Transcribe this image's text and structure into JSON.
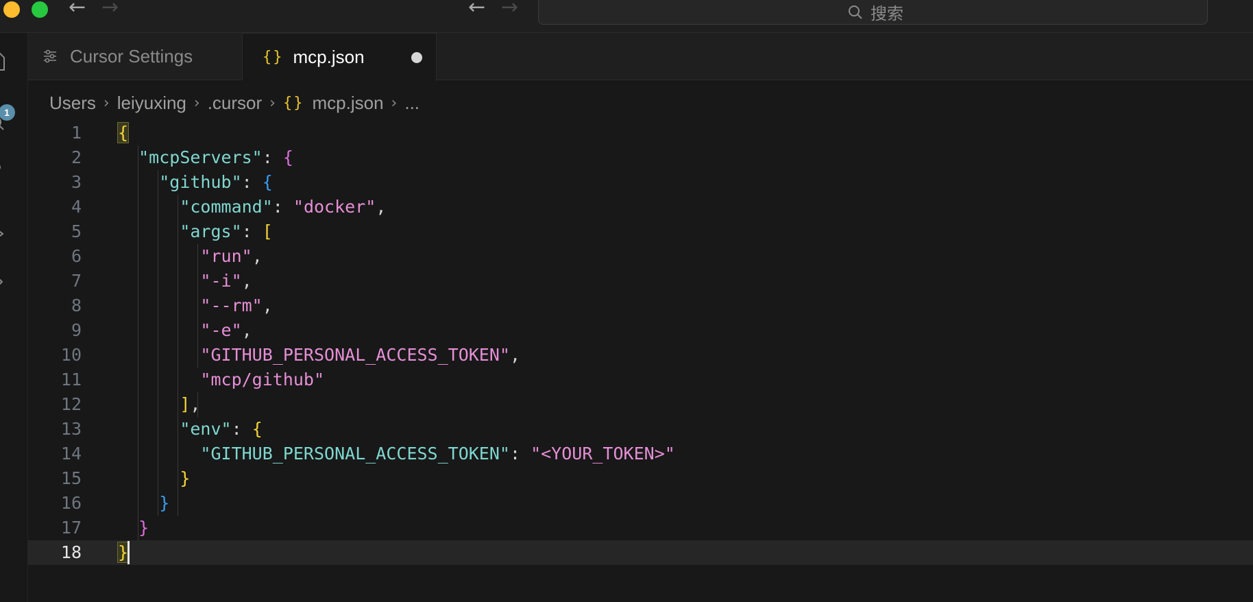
{
  "titlebar": {
    "search_placeholder": "搜索",
    "back_icon": "arrow-left-icon",
    "forward_icon": "arrow-right-icon",
    "search_icon": "magnifier-icon"
  },
  "activity_bar": {
    "badge_count": "1"
  },
  "tabs": [
    {
      "label": "Cursor Settings",
      "icon": "settings-sliders-icon",
      "active": false
    },
    {
      "label": "mcp.json",
      "icon": "json-braces-icon",
      "icon_text": "{}",
      "active": true,
      "dirty": true
    }
  ],
  "breadcrumb": [
    "Users",
    "leiyuxing",
    ".cursor",
    "mcp.json",
    "..."
  ],
  "breadcrumb_icon_text": "{}",
  "editor": {
    "current_line": 18,
    "lines": [
      {
        "n": "1",
        "tokens": [
          {
            "t": "{",
            "c": "t-b1 t-bhl"
          }
        ]
      },
      {
        "n": "2",
        "tokens": [
          {
            "t": "  "
          },
          {
            "t": "\"mcpServers\"",
            "c": "t-key"
          },
          {
            "t": ": ",
            "c": "t-punc"
          },
          {
            "t": "{",
            "c": "t-b2"
          }
        ]
      },
      {
        "n": "3",
        "tokens": [
          {
            "t": "    "
          },
          {
            "t": "\"github\"",
            "c": "t-key"
          },
          {
            "t": ": ",
            "c": "t-punc"
          },
          {
            "t": "{",
            "c": "t-b3"
          }
        ]
      },
      {
        "n": "4",
        "tokens": [
          {
            "t": "      "
          },
          {
            "t": "\"command\"",
            "c": "t-key"
          },
          {
            "t": ": ",
            "c": "t-punc"
          },
          {
            "t": "\"docker\"",
            "c": "t-str"
          },
          {
            "t": ",",
            "c": "t-punc"
          }
        ]
      },
      {
        "n": "5",
        "tokens": [
          {
            "t": "      "
          },
          {
            "t": "\"args\"",
            "c": "t-key"
          },
          {
            "t": ": ",
            "c": "t-punc"
          },
          {
            "t": "[",
            "c": "t-b1"
          }
        ]
      },
      {
        "n": "6",
        "tokens": [
          {
            "t": "        "
          },
          {
            "t": "\"run\"",
            "c": "t-str"
          },
          {
            "t": ",",
            "c": "t-punc"
          }
        ]
      },
      {
        "n": "7",
        "tokens": [
          {
            "t": "        "
          },
          {
            "t": "\"-i\"",
            "c": "t-str"
          },
          {
            "t": ",",
            "c": "t-punc"
          }
        ]
      },
      {
        "n": "8",
        "tokens": [
          {
            "t": "        "
          },
          {
            "t": "\"--rm\"",
            "c": "t-str"
          },
          {
            "t": ",",
            "c": "t-punc"
          }
        ]
      },
      {
        "n": "9",
        "tokens": [
          {
            "t": "        "
          },
          {
            "t": "\"-e\"",
            "c": "t-str"
          },
          {
            "t": ",",
            "c": "t-punc"
          }
        ]
      },
      {
        "n": "10",
        "tokens": [
          {
            "t": "        "
          },
          {
            "t": "\"GITHUB_PERSONAL_ACCESS_TOKEN\"",
            "c": "t-str"
          },
          {
            "t": ",",
            "c": "t-punc"
          }
        ]
      },
      {
        "n": "11",
        "tokens": [
          {
            "t": "        "
          },
          {
            "t": "\"mcp/github\"",
            "c": "t-str"
          }
        ]
      },
      {
        "n": "12",
        "tokens": [
          {
            "t": "      "
          },
          {
            "t": "]",
            "c": "t-b1"
          },
          {
            "t": ",",
            "c": "t-punc"
          }
        ]
      },
      {
        "n": "13",
        "tokens": [
          {
            "t": "      "
          },
          {
            "t": "\"env\"",
            "c": "t-key"
          },
          {
            "t": ": ",
            "c": "t-punc"
          },
          {
            "t": "{",
            "c": "t-b1"
          }
        ]
      },
      {
        "n": "14",
        "tokens": [
          {
            "t": "        "
          },
          {
            "t": "\"GITHUB_PERSONAL_ACCESS_TOKEN\"",
            "c": "t-key"
          },
          {
            "t": ": ",
            "c": "t-punc"
          },
          {
            "t": "\"<YOUR_TOKEN>\"",
            "c": "t-str"
          }
        ]
      },
      {
        "n": "15",
        "tokens": [
          {
            "t": "      "
          },
          {
            "t": "}",
            "c": "t-b1"
          }
        ]
      },
      {
        "n": "16",
        "tokens": [
          {
            "t": "    "
          },
          {
            "t": "}",
            "c": "t-b3"
          }
        ]
      },
      {
        "n": "17",
        "tokens": [
          {
            "t": "  "
          },
          {
            "t": "}",
            "c": "t-b2"
          }
        ]
      },
      {
        "n": "18",
        "tokens": [
          {
            "t": "}",
            "c": "t-b1 t-bhl"
          }
        ]
      }
    ]
  },
  "colors": {
    "background": "#181818",
    "key": "#7fd7d0",
    "string": "#e68fd6",
    "bracket_gold": "#f5d33a",
    "bracket_magenta": "#d86fd8",
    "bracket_blue": "#3a9bf0"
  }
}
